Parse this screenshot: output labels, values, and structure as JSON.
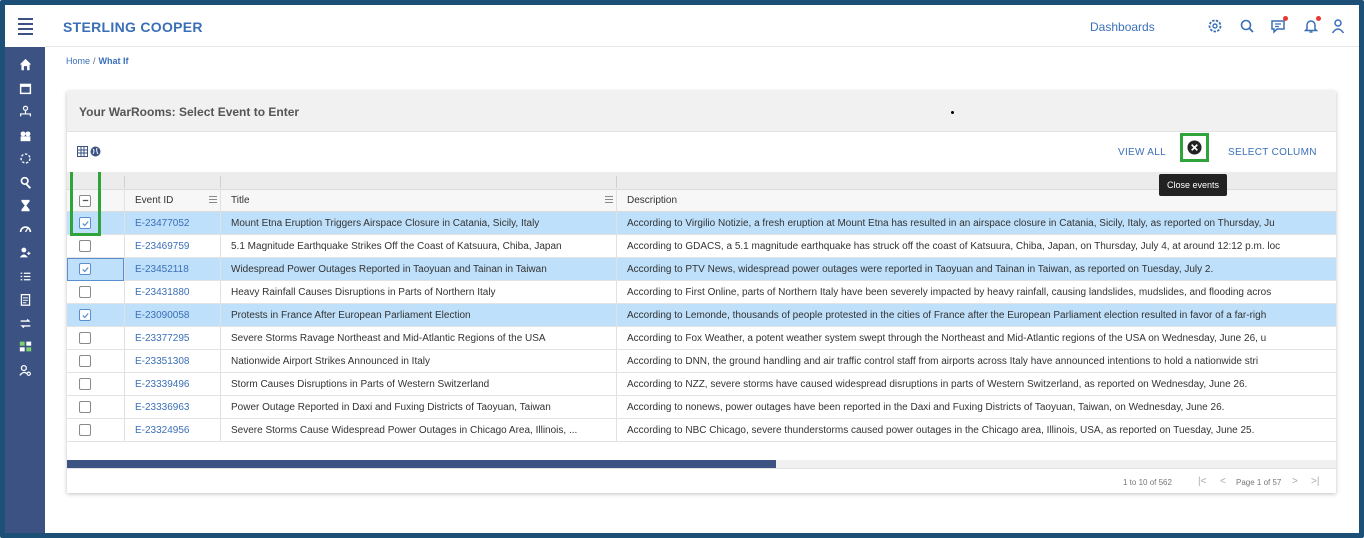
{
  "app": {
    "brand": "STERLING COOPER",
    "dashboards_label": "Dashboards"
  },
  "sidebar": {
    "icons": [
      "home-icon",
      "calendar-icon",
      "org-chart-icon",
      "buildings-icon",
      "refresh-icon",
      "search-person-icon",
      "hourglass-icon",
      "gauge-icon",
      "user-add-icon",
      "list-icon",
      "clipboard-icon",
      "transfer-icon",
      "dashboard-grid-icon",
      "user-settings-icon"
    ]
  },
  "breadcrumb": {
    "home": "Home",
    "separator": "/",
    "current": "What If"
  },
  "panel": {
    "title": "Your WarRooms: Select Event to Enter",
    "view_all": "VIEW ALL",
    "select_column": "SELECT COLUMN",
    "tooltip": "Close events"
  },
  "grid": {
    "headers": {
      "event_id": "Event ID",
      "title": "Title",
      "description": "Description"
    },
    "rows": [
      {
        "checked": true,
        "id": "E-23477052",
        "title": "Mount Etna Eruption Triggers Airspace Closure in Catania, Sicily, Italy",
        "desc": "According to Virgilio Notizie, a fresh eruption at Mount Etna has resulted in an airspace closure in Catania, Sicily, Italy, as reported on Thursday, Ju"
      },
      {
        "checked": false,
        "id": "E-23469759",
        "title": "5.1 Magnitude Earthquake Strikes Off the Coast of Katsuura, Chiba, Japan",
        "desc": "According to GDACS, a 5.1 magnitude earthquake has struck off the coast of Katsuura, Chiba, Japan, on Thursday, July 4, at around 12:12 p.m. loc"
      },
      {
        "checked": true,
        "id": "E-23452118",
        "title": "Widespread Power Outages Reported in Taoyuan and Tainan in Taiwan",
        "desc": "According to PTV News, widespread power outages were reported in Taoyuan and Tainan in Taiwan, as reported on Tuesday, July 2."
      },
      {
        "checked": false,
        "id": "E-23431880",
        "title": "Heavy Rainfall Causes Disruptions in Parts of Northern Italy",
        "desc": "According to First Online, parts of Northern Italy have been severely impacted by heavy rainfall, causing landslides, mudslides, and flooding acros"
      },
      {
        "checked": true,
        "id": "E-23090058",
        "title": "Protests in France After European Parliament Election",
        "desc": "According to Lemonde, thousands of people protested in the cities of France after the European Parliament election resulted in favor of a far-righ"
      },
      {
        "checked": false,
        "id": "E-23377295",
        "title": "Severe Storms Ravage Northeast and Mid-Atlantic Regions of the USA",
        "desc": "According to Fox Weather, a potent weather system swept through the Northeast and Mid-Atlantic regions of the USA on Wednesday, June 26, u"
      },
      {
        "checked": false,
        "id": "E-23351308",
        "title": "Nationwide Airport Strikes Announced in Italy",
        "desc": "According to DNN, the ground handling and air traffic control staff from airports across Italy have announced intentions to hold a nationwide stri"
      },
      {
        "checked": false,
        "id": "E-23339496",
        "title": "Storm Causes Disruptions in Parts of Western Switzerland",
        "desc": "According to NZZ, severe storms have caused widespread disruptions in parts of Western Switzerland, as reported on Wednesday, June 26."
      },
      {
        "checked": false,
        "id": "E-23336963",
        "title": "Power Outage Reported in Daxi and Fuxing Districts of Taoyuan, Taiwan",
        "desc": "According to nonews, power outages have been reported in the Daxi and Fuxing Districts of Taoyuan, Taiwan, on Wednesday, June 26."
      },
      {
        "checked": false,
        "id": "E-23324956",
        "title": "Severe Storms Cause Widespread Power Outages in Chicago Area, Illinois, ...",
        "desc": "According to NBC Chicago, severe thunderstorms caused power outages in the Chicago area, Illinois, USA, as reported on Tuesday, June 25."
      }
    ]
  },
  "pagination": {
    "range": "1 to 10 of 562",
    "page": "Page 1 of 57",
    "first": "|<",
    "prev": "<",
    "next": ">",
    "last": ">|"
  },
  "colors": {
    "sidebar": "#3b5283",
    "accent": "#3a6fb7",
    "selected_row": "#bfe0fa",
    "highlight": "#2fa43a"
  }
}
